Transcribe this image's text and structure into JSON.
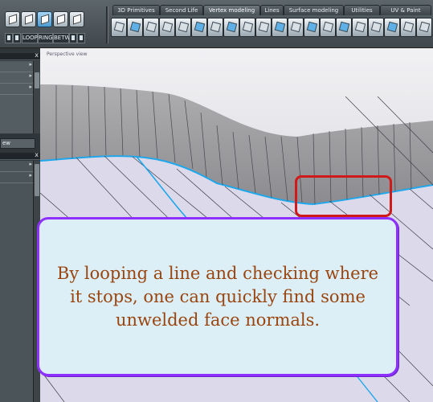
{
  "toolbar": {
    "left_buttons": {
      "loop": "LOOP",
      "ring": "RING",
      "betw": "BETW"
    },
    "tabs": [
      {
        "label": "3D Primitives"
      },
      {
        "label": "Second Life"
      },
      {
        "label": "Vertex modeling",
        "selected": true
      },
      {
        "label": "Lines"
      },
      {
        "label": "Surface modeling"
      },
      {
        "label": "Utilities"
      },
      {
        "label": "UV & Paint"
      }
    ]
  },
  "left_panel": {
    "close_glyph": "x",
    "view_button_partial": "ew"
  },
  "viewport": {
    "label": "Perspective view",
    "callout": "By looping a line and checking where\nit stops, one can quickly find some\nunwelded face normals."
  },
  "colors": {
    "callout_border": "#8e30ff",
    "callout_fill": "#dceff6",
    "callout_text": "#9a4510",
    "highlight": "#d01a1a",
    "selected_edge": "#1ea7ea"
  }
}
